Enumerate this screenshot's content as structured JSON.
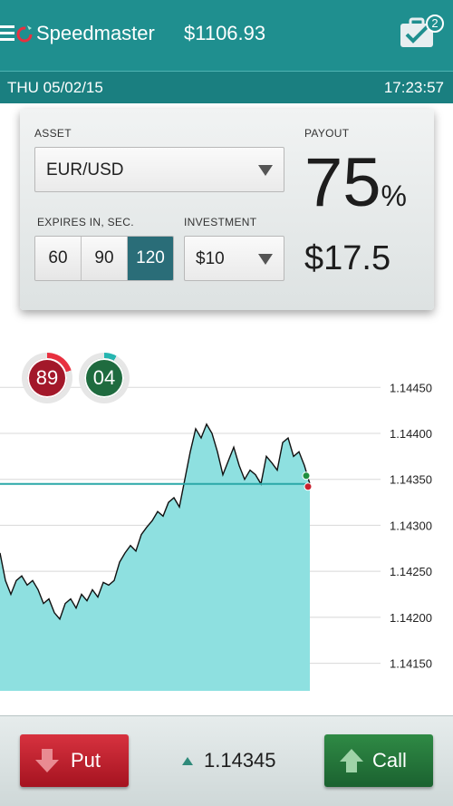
{
  "header": {
    "title": "Speedmaster",
    "balance": "$1106.93",
    "badge_count": "2",
    "icons": [
      "menu-icon",
      "logo-icon",
      "briefcase-check-icon"
    ]
  },
  "datebar": {
    "date": "THU 05/02/15",
    "time": "17:23:57"
  },
  "card": {
    "asset_label": "ASSET",
    "asset_value": "EUR/USD",
    "expires_label": "EXPIRES IN, SEC.",
    "expires_options": [
      "60",
      "90",
      "120"
    ],
    "expires_selected": "120",
    "investment_label": "INVESTMENT",
    "investment_value": "$10",
    "payout_label": "PAYOUT",
    "payout_percent": "75",
    "payout_percent_sign": "%",
    "payout_amount": "$17.5"
  },
  "counters": [
    {
      "value": "89",
      "color": "#a3182a",
      "progress": 0.2
    },
    {
      "value": "04",
      "color": "#1f6b3f",
      "progress": 0.08
    }
  ],
  "chart_data": {
    "type": "area",
    "y_ticks": [
      "1.14450",
      "1.14400",
      "1.14350",
      "1.14300",
      "1.14250",
      "1.14200",
      "1.14150"
    ],
    "ylim": [
      1.1412,
      1.1447
    ],
    "current_price_line": 1.14345,
    "fill_color": "#8ee0e0",
    "line_color": "#111111",
    "grid": true,
    "x": [
      0,
      6,
      12,
      18,
      24,
      30,
      36,
      42,
      48,
      54,
      60,
      66,
      72,
      78,
      84,
      90,
      96,
      102,
      108,
      114,
      120,
      126,
      132,
      138,
      144,
      150,
      156,
      162,
      168,
      174,
      180,
      186,
      192,
      198,
      204,
      210,
      216,
      222,
      228,
      234,
      240,
      246,
      252,
      258,
      264,
      270,
      276,
      282,
      288,
      294,
      300,
      306,
      312,
      318,
      324,
      330,
      336,
      342
    ],
    "y": [
      1.1427,
      1.1424,
      1.14225,
      1.1424,
      1.14245,
      1.14235,
      1.1424,
      1.1423,
      1.14215,
      1.1422,
      1.14205,
      1.14198,
      1.14215,
      1.1422,
      1.1421,
      1.14225,
      1.14218,
      1.1423,
      1.14222,
      1.14238,
      1.14235,
      1.1424,
      1.1426,
      1.1427,
      1.14278,
      1.14272,
      1.1429,
      1.14298,
      1.14305,
      1.14315,
      1.1431,
      1.14325,
      1.1433,
      1.1432,
      1.1435,
      1.1438,
      1.14405,
      1.14395,
      1.1441,
      1.144,
      1.1438,
      1.14355,
      1.1437,
      1.14385,
      1.14365,
      1.1435,
      1.1436,
      1.14355,
      1.14345,
      1.14375,
      1.14368,
      1.1436,
      1.1439,
      1.14395,
      1.14375,
      1.1438,
      1.14365,
      1.14345
    ]
  },
  "bottom": {
    "put_label": "Put",
    "call_label": "Call",
    "price": "1.14345"
  }
}
